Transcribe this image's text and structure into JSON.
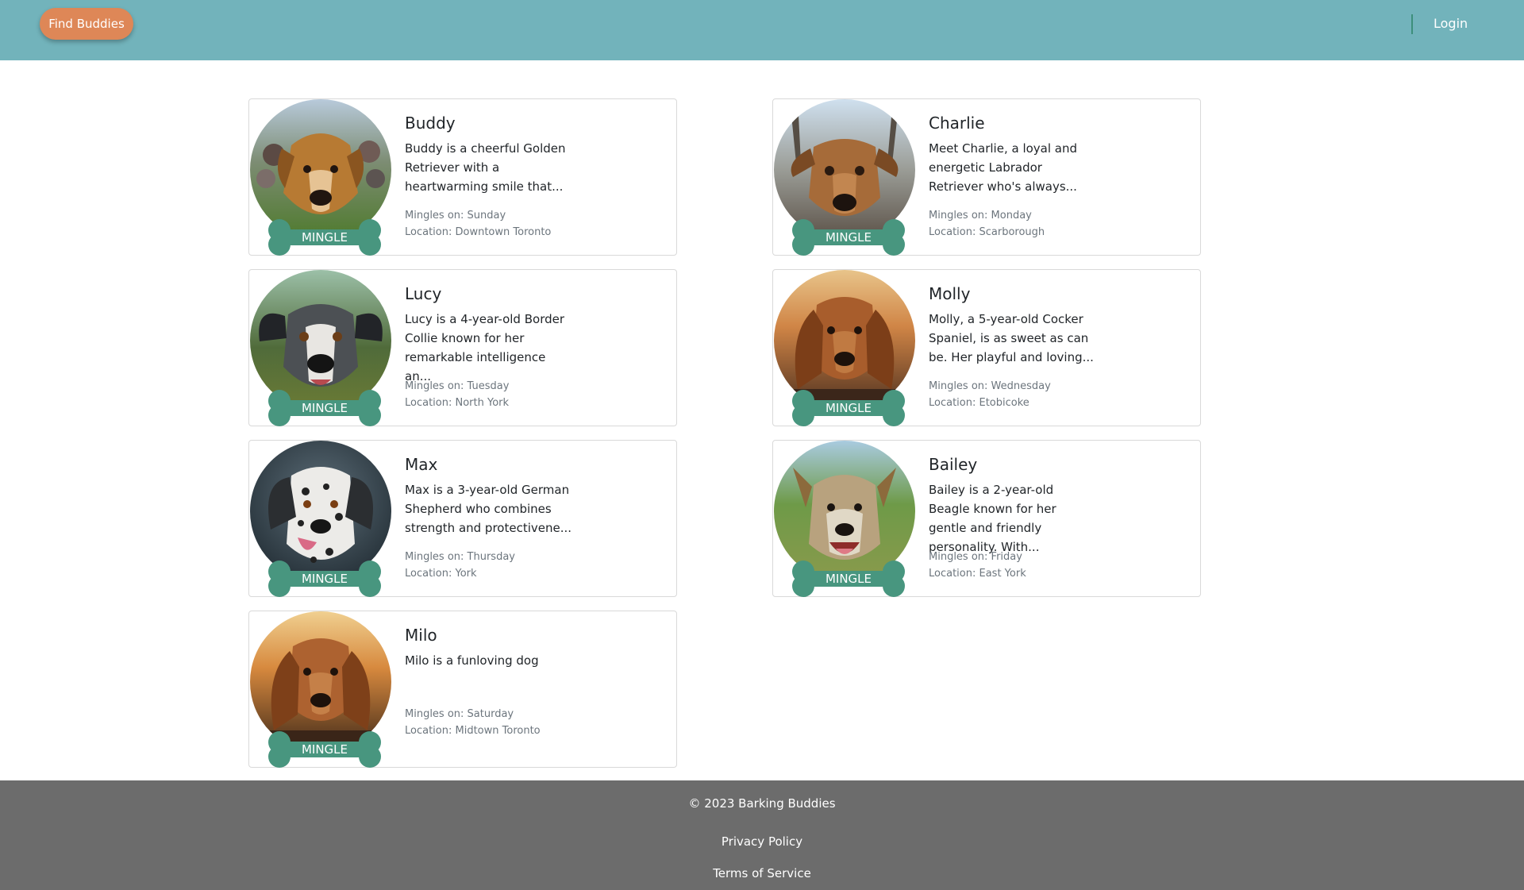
{
  "colors": {
    "header_bg": "#72b3bb",
    "accent_button": "#de8757",
    "mingle_bone": "#48967f",
    "footer_bg": "#6c6c6c"
  },
  "header": {
    "find_buddies_label": "Find Buddies",
    "login_label": "Login"
  },
  "dogs": [
    {
      "name": "Buddy",
      "description": "Buddy is a cheerful Golden Retriever with a heartwarming smile that...",
      "mingles_on": "Mingles on: Sunday",
      "location": "Location: Downtown Toronto",
      "mingle_label": "MINGLE",
      "photo_icon": "golden-retriever-photo"
    },
    {
      "name": "Charlie",
      "description": "Meet Charlie, a loyal and energetic Labrador Retriever who's always...",
      "mingles_on": "Mingles on: Monday",
      "location": "Location: Scarborough",
      "mingle_label": "MINGLE",
      "photo_icon": "labrador-photo"
    },
    {
      "name": "Lucy",
      "description": "Lucy is a 4-year-old Border Collie known for her remarkable intelligence an...",
      "mingles_on": "Mingles on: Tuesday",
      "location": "Location: North York",
      "mingle_label": "MINGLE",
      "photo_icon": "border-collie-photo"
    },
    {
      "name": "Molly",
      "description": "Molly, a 5-year-old Cocker Spaniel, is as sweet as can be. Her playful and loving...",
      "mingles_on": "Mingles on: Wednesday",
      "location": "Location: Etobicoke",
      "mingle_label": "MINGLE",
      "photo_icon": "cocker-spaniel-photo"
    },
    {
      "name": "Max",
      "description": "Max is a 3-year-old German Shepherd who combines strength and protectivene...",
      "mingles_on": "Mingles on: Thursday",
      "location": "Location: York",
      "mingle_label": "MINGLE",
      "photo_icon": "spotted-dog-photo"
    },
    {
      "name": "Bailey",
      "description": "Bailey is a 2-year-old Beagle known for her gentle and friendly personality. With...",
      "mingles_on": "Mingles on: Friday",
      "location": "Location: East York",
      "mingle_label": "MINGLE",
      "photo_icon": "terrier-photo"
    },
    {
      "name": "Milo",
      "description": "Milo is a funloving dog",
      "mingles_on": "Mingles on: Saturday",
      "location": "Location: Midtown Toronto",
      "mingle_label": "MINGLE",
      "photo_icon": "spaniel-sunset-photo"
    }
  ],
  "footer": {
    "copyright": "© 2023 Barking Buddies",
    "privacy_label": "Privacy Policy",
    "terms_label": "Terms of Service"
  }
}
